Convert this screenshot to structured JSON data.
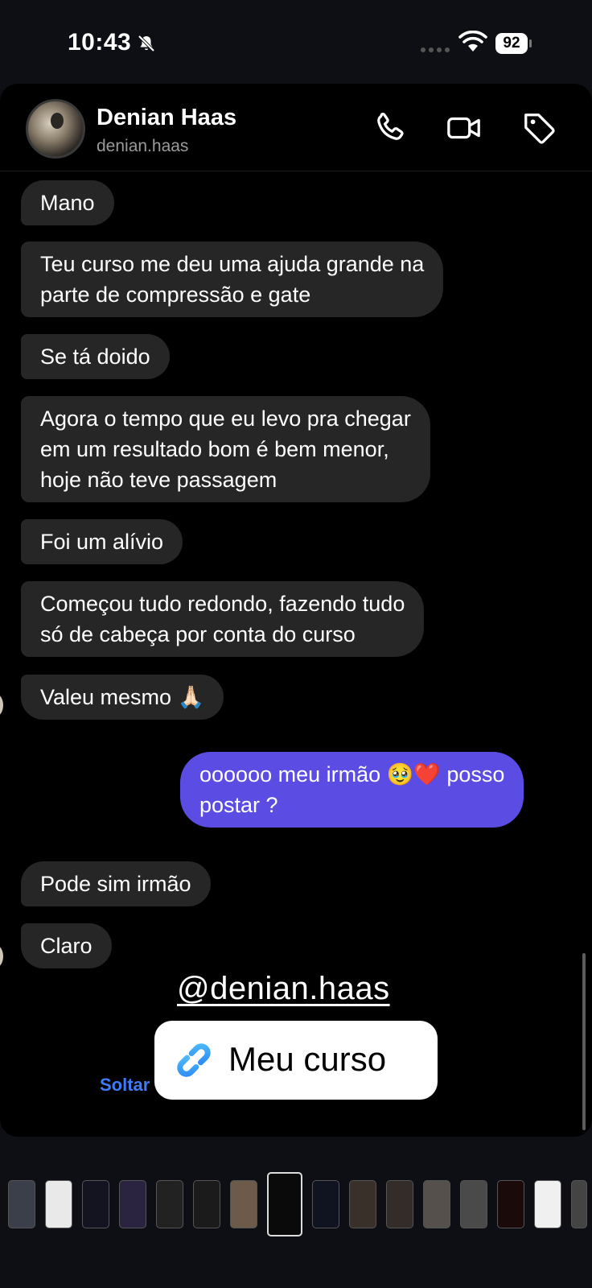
{
  "status_bar": {
    "time": "10:43",
    "battery": "92",
    "icons": [
      "bell-slash-icon",
      "cellular-signal-icon",
      "wifi-icon",
      "battery-icon"
    ]
  },
  "header": {
    "name": "Denian Haas",
    "username": "denian.haas",
    "icons": [
      "phone-icon",
      "video-camera-icon",
      "tag-icon"
    ]
  },
  "messages": [
    {
      "from": "them",
      "lines": [
        "Mano"
      ]
    },
    {
      "from": "them",
      "lines": [
        "Teu curso me deu uma ajuda grande na",
        "parte de compressão e gate"
      ]
    },
    {
      "from": "them",
      "lines": [
        "Se tá doido"
      ]
    },
    {
      "from": "them",
      "lines": [
        "Agora o tempo que eu levo pra chegar",
        "em um resultado bom é bem menor,",
        "hoje não teve passagem"
      ]
    },
    {
      "from": "them",
      "lines": [
        "Foi um alívio"
      ]
    },
    {
      "from": "them",
      "lines": [
        "Começou tudo redondo, fazendo tudo",
        "só de cabeça por conta do curso"
      ]
    },
    {
      "from": "them",
      "lines": [
        "Valeu mesmo 🙏🏻"
      ]
    },
    {
      "from": "me",
      "lines": [
        "oooooo meu irmão 🥹❤️ posso",
        "postar ?"
      ]
    },
    {
      "from": "them",
      "lines": [
        "Pode sim irmão"
      ]
    },
    {
      "from": "them",
      "lines": [
        "Claro"
      ]
    }
  ],
  "overlay": {
    "mention": "@denian.haas",
    "link_sticker_label": "Meu curso",
    "release_hint": "Soltar"
  },
  "colors": {
    "background": "#0d0f14",
    "incoming_bubble": "#262626",
    "outgoing_bubble": "#5b4de3",
    "hint_blue": "#3d7bf7"
  }
}
